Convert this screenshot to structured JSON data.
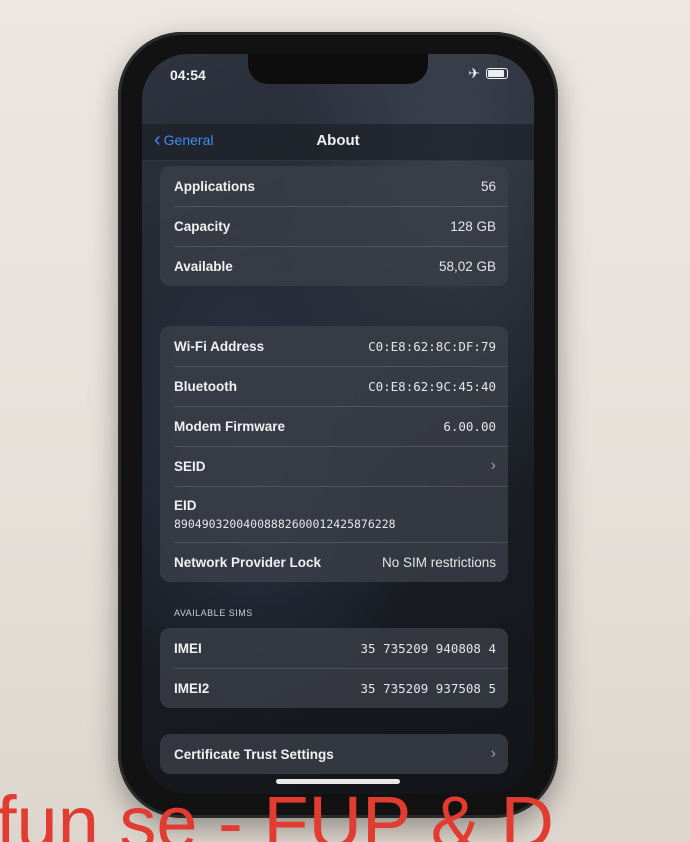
{
  "status_bar": {
    "time": "04:54",
    "airplane_icon": "✈"
  },
  "nav": {
    "back_label": "General",
    "title": "About"
  },
  "storage": [
    {
      "label": "Applications",
      "value": "56"
    },
    {
      "label": "Capacity",
      "value": "128 GB"
    },
    {
      "label": "Available",
      "value": "58,02 GB"
    }
  ],
  "network": {
    "wifi": {
      "label": "Wi-Fi Address",
      "value": "C0:E8:62:8C:DF:79"
    },
    "bluetooth": {
      "label": "Bluetooth",
      "value": "C0:E8:62:9C:45:40"
    },
    "modem": {
      "label": "Modem Firmware",
      "value": "6.00.00"
    },
    "seid": {
      "label": "SEID"
    },
    "eid": {
      "label": "EID",
      "value": "89049032004008882600012425876228"
    },
    "provider_lock": {
      "label": "Network Provider Lock",
      "value": "No SIM restrictions"
    }
  },
  "sims": {
    "header": "AVAILABLE SIMS",
    "imei": {
      "label": "IMEI",
      "value": "35 735209 940808 4"
    },
    "imei2": {
      "label": "IMEI2",
      "value": "35 735209 937508 5"
    }
  },
  "certificate": {
    "label": "Certificate Trust Settings"
  },
  "watermark": "fun se - FUP & D",
  "colors": {
    "accent": "#3d8cf5",
    "watermark": "#e23b2f"
  }
}
